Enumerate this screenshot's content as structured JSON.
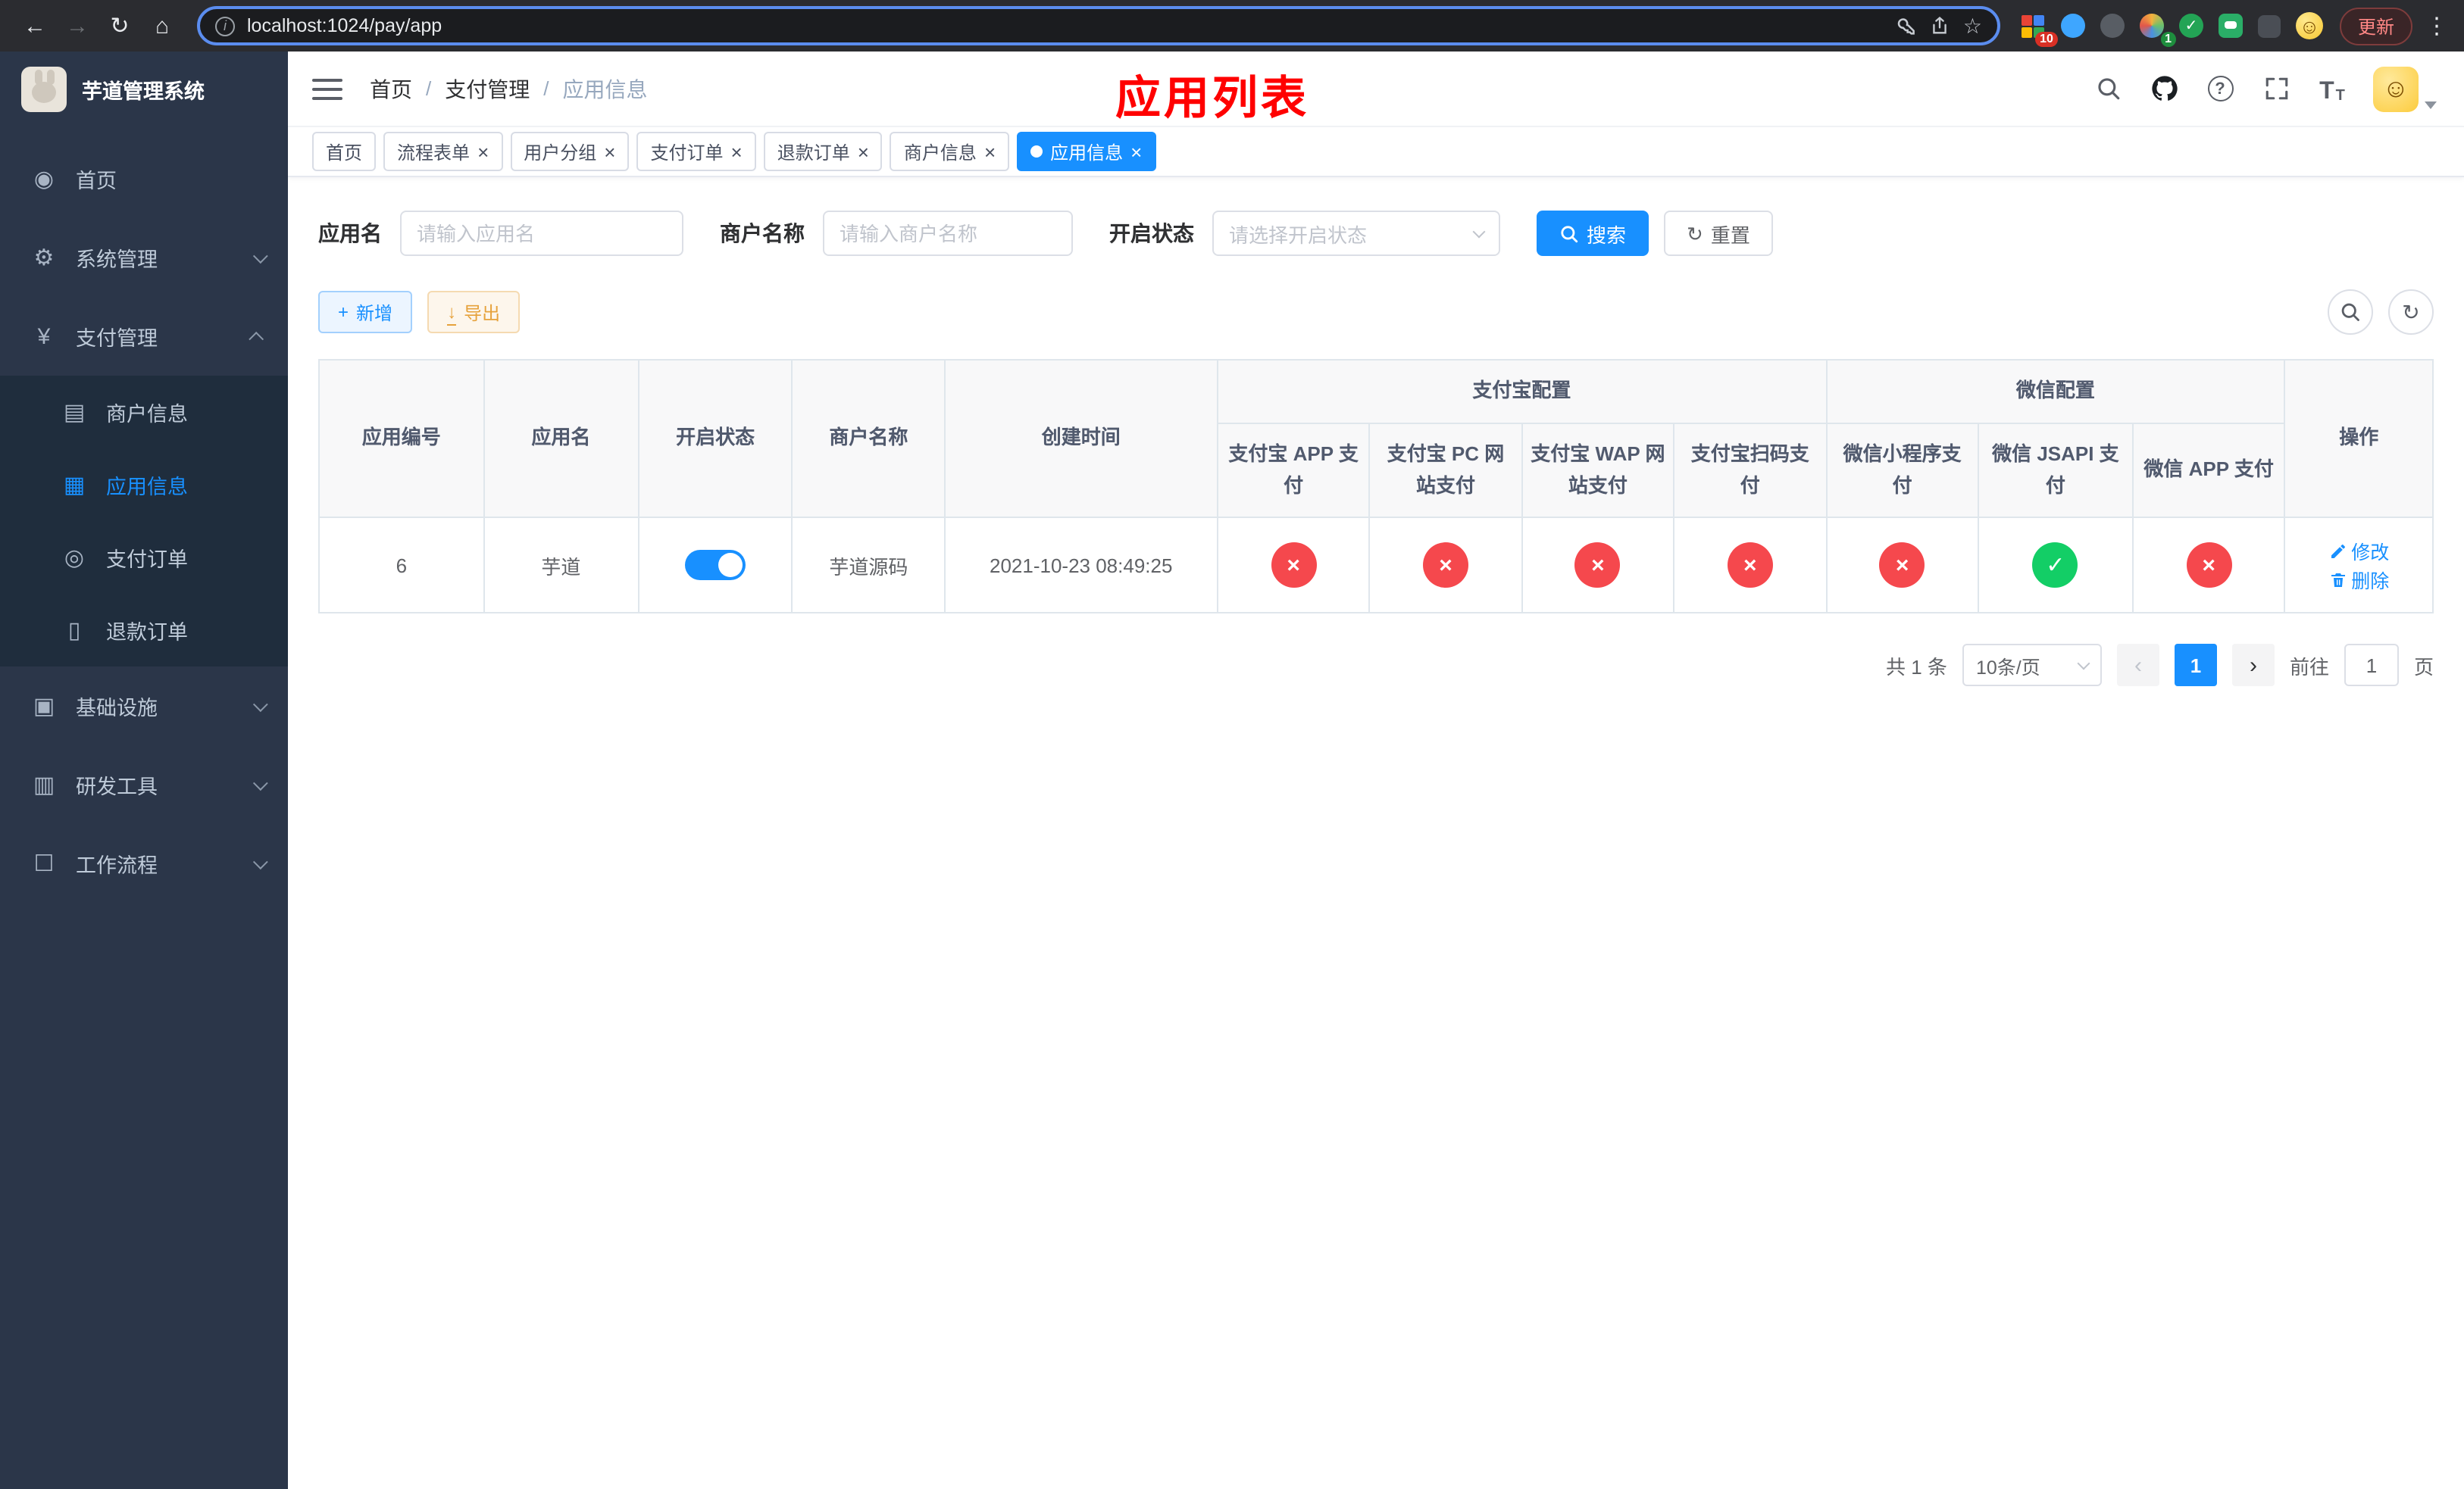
{
  "colors": {
    "accent": "#1890ff",
    "danger": "#f5484d",
    "success": "#13ce66",
    "title-red": "#ff0000"
  },
  "icons": {
    "back": "←",
    "forward": "→",
    "refresh": "↻",
    "home": "⌂",
    "info": "i",
    "star": "☆",
    "dots": "⋮",
    "close": "×",
    "check": "✓",
    "cross": "×",
    "plus": "+",
    "download": "↓",
    "prev": "‹",
    "next": "›",
    "question": "?",
    "font": "T",
    "face": "☺",
    "ext_check": "✓"
  },
  "browser": {
    "url": "localhost:1024/pay/app",
    "update_label": "更新",
    "ext_badges": {
      "blocks": "10",
      "avatar": "1"
    }
  },
  "sidebar": {
    "logo_title": "芋道管理系统",
    "menu": [
      {
        "label": "首页",
        "glyph": "◉"
      },
      {
        "label": "系统管理",
        "glyph": "⚙"
      },
      {
        "label": "支付管理",
        "glyph": "¥"
      },
      {
        "label": "商户信息",
        "glyph": "▤"
      },
      {
        "label": "应用信息",
        "glyph": "▦"
      },
      {
        "label": "支付订单",
        "glyph": "◎"
      },
      {
        "label": "退款订单",
        "glyph": "▯"
      },
      {
        "label": "基础设施",
        "glyph": "▣"
      },
      {
        "label": "研发工具",
        "glyph": "▥"
      },
      {
        "label": "工作流程",
        "glyph": "☐"
      }
    ]
  },
  "header": {
    "breadcrumb": [
      "首页",
      "支付管理",
      "应用信息"
    ],
    "page_title": "应用列表"
  },
  "tabs": [
    {
      "label": "首页"
    },
    {
      "label": "流程表单"
    },
    {
      "label": "用户分组"
    },
    {
      "label": "支付订单"
    },
    {
      "label": "退款订单"
    },
    {
      "label": "商户信息"
    },
    {
      "label": "应用信息"
    }
  ],
  "filters": {
    "app_name": {
      "label": "应用名",
      "placeholder": "请输入应用名"
    },
    "merchant": {
      "label": "商户名称",
      "placeholder": "请输入商户名称"
    },
    "status": {
      "label": "开启状态",
      "placeholder": "请选择开启状态"
    },
    "search_label": "搜索",
    "reset_label": "重置"
  },
  "toolbar": {
    "add_label": "新增",
    "export_label": "导出"
  },
  "table": {
    "columns": [
      "应用编号",
      "应用名",
      "开启状态",
      "商户名称",
      "创建时间"
    ],
    "groups": [
      {
        "label": "支付宝配置",
        "subs": [
          "支付宝 APP 支付",
          "支付宝 PC 网站支付",
          "支付宝 WAP 网站支付",
          "支付宝扫码支付"
        ]
      },
      {
        "label": "微信配置",
        "subs": [
          "微信小程序支付",
          "微信 JSAPI 支付",
          "微信 APP 支付"
        ]
      }
    ],
    "ops_label": "操作",
    "row": {
      "id": "6",
      "name": "芋道",
      "enabled": true,
      "merchant": "芋道源码",
      "created": "2021-10-23 08:49:25",
      "channels": [
        {
          "name": "alipay-app",
          "ok": false
        },
        {
          "name": "alipay-pc",
          "ok": false
        },
        {
          "name": "alipay-wap",
          "ok": false
        },
        {
          "name": "alipay-qr",
          "ok": false
        },
        {
          "name": "wechat-lite",
          "ok": false
        },
        {
          "name": "wechat-jsapi",
          "ok": true
        },
        {
          "name": "wechat-app",
          "ok": false
        }
      ],
      "edit_label": "修改",
      "delete_label": "删除"
    }
  },
  "pagination": {
    "total": "共 1 条",
    "page_size": "10条/页",
    "current_page": "1",
    "goto_label": "前往",
    "goto_value": "1",
    "page_unit": "页"
  }
}
